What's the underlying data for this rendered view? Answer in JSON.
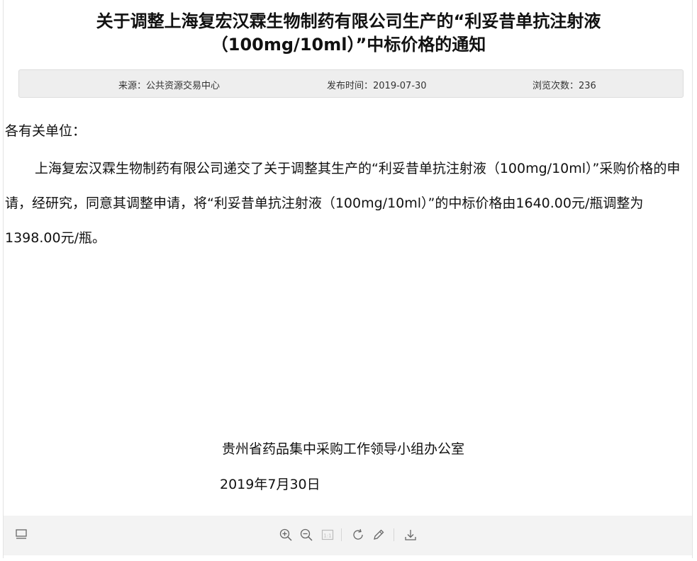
{
  "document": {
    "title_line1": "关于调整上海复宏汉霖生物制药有限公司生产的“利妥昔单抗注射液",
    "title_line2": "（100mg/10ml）”中标价格的通知",
    "meta": {
      "source": "来源：公共资源交易中心",
      "publish_time": "发布时间：2019-07-30",
      "views": "浏览次数：236"
    },
    "salutation": "各有关单位：",
    "body": "上海复宏汉霖生物制药有限公司递交了关于调整其生产的“利妥昔单抗注射液（100mg/10ml）”采购价格的申请，经研究，同意其调整申请，将“利妥昔单抗注射液（100mg/10ml）”的中标价格由1640.00元/瓶调整为1398.00元/瓶。",
    "signature_org": "贵州省药品集中采购工作领导小组办公室",
    "signature_date": "2019年7月30日"
  },
  "toolbar": {
    "icons": [
      "sidebar-toggle-icon",
      "zoom-in-icon",
      "zoom-out-icon",
      "actual-size-icon",
      "rotate-icon",
      "annotate-pen-icon",
      "download-icon"
    ],
    "actual_size_label": "1:1"
  },
  "colors": {
    "meta_bar_bg": "#eeeeee",
    "toolbar_bg": "#f3f3f3",
    "icon": "#666666"
  }
}
